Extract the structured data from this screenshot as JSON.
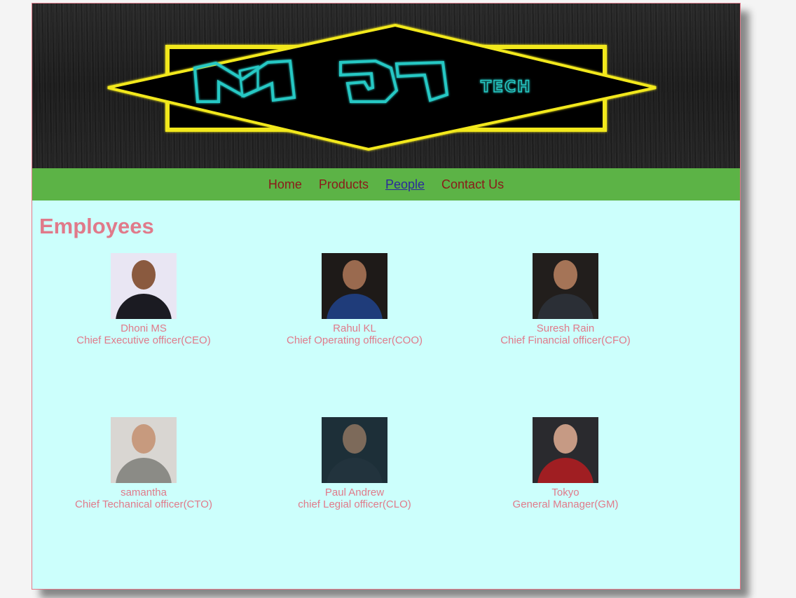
{
  "banner": {
    "logo_alt": "MJ TECH logo",
    "logo_text_main": "MJ",
    "logo_text_sub": "TECH"
  },
  "nav": {
    "items": [
      {
        "label": "Home",
        "active": false
      },
      {
        "label": "Products",
        "active": false
      },
      {
        "label": "People",
        "active": true
      },
      {
        "label": "Contact Us",
        "active": false
      }
    ]
  },
  "main": {
    "title": "Employees",
    "employees": [
      {
        "name": "Dhoni MS",
        "role": "Chief Executive officer(CEO)",
        "photo_bg": "#e9e6f3",
        "skin": "#8a5a3f",
        "clothes": "#1b1b22"
      },
      {
        "name": "Rahul KL",
        "role": "Chief Operating officer(COO)",
        "photo_bg": "#1e1a18",
        "skin": "#9a6a4f",
        "clothes": "#1f3c7a"
      },
      {
        "name": "Suresh Rain",
        "role": "Chief Financial officer(CFO)",
        "photo_bg": "#221e1c",
        "skin": "#a57457",
        "clothes": "#2b2f36"
      },
      {
        "name": "samantha",
        "role": "Chief Techanical officer(CTO)",
        "photo_bg": "#d9d6d2",
        "skin": "#c79a7e",
        "clothes": "#8b8b86"
      },
      {
        "name": "Paul Andrew",
        "role": "chief Legial officer(CLO)",
        "photo_bg": "#1d2f38",
        "skin": "#7d6a5a",
        "clothes": "#22333d"
      },
      {
        "name": "Tokyo",
        "role": "General Manager(GM)",
        "photo_bg": "#2a2a2e",
        "skin": "#c69a84",
        "clothes": "#a01e22"
      }
    ]
  }
}
